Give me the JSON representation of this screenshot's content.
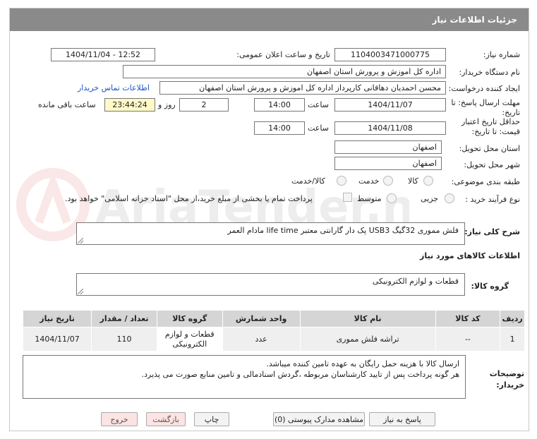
{
  "header": {
    "title": "جزئیات اطلاعات نیاز"
  },
  "fields": {
    "need_number_label": "شماره نیاز:",
    "need_number": "1104003471000775",
    "announce_label": "تاریخ و ساعت اعلان عمومی:",
    "announce_value": "1404/11/04 - 12:52",
    "buyer_label": "نام دستگاه خریدار:",
    "buyer_value": "اداره کل اموزش و پرورش استان اصفهان",
    "creator_label": "ایجاد کننده درخواست:",
    "creator_value": "محسن احمدیان دهاقانی کارپرداز اداره کل اموزش و پرورش استان اصفهان",
    "contact_link": "اطلاعات تماس خریدار",
    "send_deadline_label": "مهلت ارسال پاسخ: تا تاریخ:",
    "send_date": "1404/11/07",
    "time_label": "ساعت",
    "send_time": "14:00",
    "days_value": "2",
    "days_label": "روز و",
    "remaining_value": "23:44:24",
    "remaining_label": "ساعت باقی مانده",
    "price_validity_label": "حداقل تاریخ اعتبار قیمت: تا تاریخ:",
    "validity_date": "1404/11/08",
    "validity_time": "14:00",
    "province_label": "استان محل تحویل:",
    "province_value": "اصفهان",
    "city_label": "شهر محل تحویل:",
    "city_value": "اصفهان",
    "category_label": "طبقه بندی موضوعی:",
    "category_options": [
      "کالا",
      "خدمت",
      "کالا/خدمت"
    ],
    "process_label": "نوع فرآیند خرید :",
    "process_options": [
      "جزیی",
      "متوسط"
    ],
    "payment_note": "پرداخت تمام یا بخشی از مبلغ خرید،از محل \"اسناد خزانه اسلامی\" خواهد بود."
  },
  "description": {
    "label": "شرح کلی نیاز:",
    "value": "فلش مموری 32گیگ USB3 پک دار گارانتی معتبر  life time مادام العمر"
  },
  "goods_info": {
    "title": "اطلاعات کالاهای مورد نیاز",
    "group_label": "گروه کالا:",
    "group_value": "قطعات و لوازم الکترونیکی"
  },
  "table": {
    "headers": [
      "ردیف",
      "کد کالا",
      "نام کالا",
      "واحد شمارش",
      "تعداد / مقدار",
      "تاریخ نیاز"
    ],
    "rows": [
      {
        "row": "1",
        "code": "--",
        "name": "تراشه فلش مموری",
        "unit": "عدد",
        "qty": "110",
        "date": "1404/11/07",
        "group": "قطعات و لوازم الکترونیکی"
      }
    ]
  },
  "buyer_notes": {
    "label": "توضیحات خریدار:",
    "line1": "ارسال کالا با هزینه حمل رایگان به عهده تامین کننده میباشد.",
    "line2": "هر گونه پرداخت پس از تایید کارشناسان مربوطه ،گردش اسنادمالی و تامین منابع صورت می پذیرد."
  },
  "buttons": {
    "reply": "پاسخ به نیاز",
    "view_docs": "مشاهده مدارک پیوستی (0)",
    "print": "چاپ",
    "back": "بازگشت",
    "exit": "خروج"
  },
  "watermark": {
    "text": "AriaTender.net"
  },
  "colors": {
    "header_bg": "#8a8a8a",
    "link": "#1a55c8",
    "highlight": "#fff9c8",
    "table_header": "#d5d5d5"
  }
}
